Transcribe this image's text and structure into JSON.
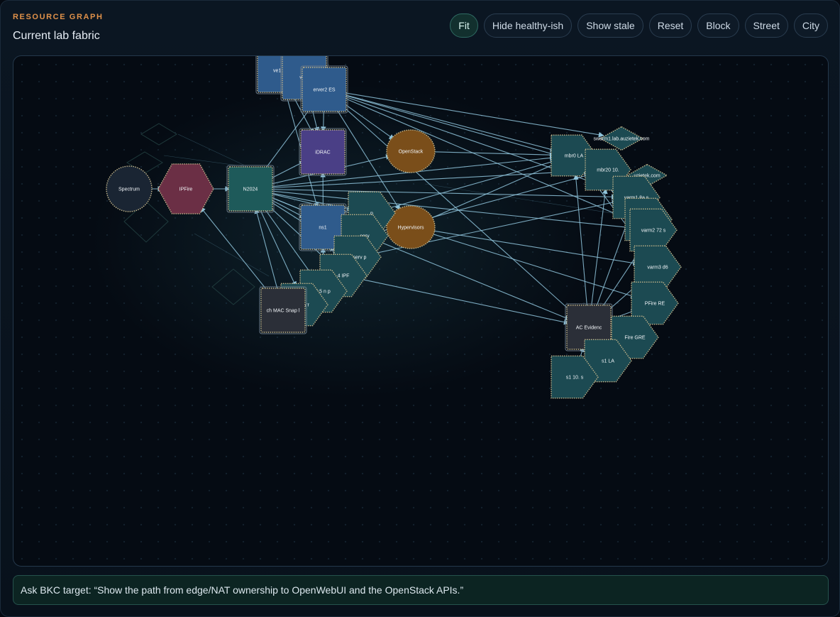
{
  "header": {
    "eyebrow": "RESOURCE GRAPH",
    "title": "Current lab fabric"
  },
  "toolbar": {
    "buttons": [
      "Fit",
      "Hide healthy-ish",
      "Show stale",
      "Reset",
      "Block",
      "Street",
      "City"
    ],
    "active": "Fit"
  },
  "ask": {
    "text": "Ask BKC target: “Show the path from edge/NAT ownership to OpenWebUI and the OpenStack APIs.”"
  },
  "colors": {
    "edge": "#8fc4dc",
    "server": "#2f5b8c",
    "idrac": "#4a3f86",
    "openstack": "#7a4e1a",
    "switch": "#1e5a5a",
    "firewall": "#6b2f45",
    "monitor": "#1a2533",
    "bridge": "#1c4a52",
    "evidence": "#2b2f38"
  },
  "graph": {
    "nodes": [
      {
        "id": "srv1",
        "label": "ve1 P",
        "kind": "server"
      },
      {
        "id": "srv2",
        "label": "ver1",
        "kind": "server"
      },
      {
        "id": "srv3",
        "label": "erver2 ES",
        "kind": "server"
      },
      {
        "id": "idrac",
        "label": "iDRAC",
        "kind": "idrac"
      },
      {
        "id": "openstack",
        "label": "OpenStack",
        "kind": "openstack"
      },
      {
        "id": "spectrum",
        "label": "Spectrum",
        "kind": "monitor"
      },
      {
        "id": "ipfire",
        "label": "IPFire",
        "kind": "firewall"
      },
      {
        "id": "n2024",
        "label": "N2024",
        "kind": "switch"
      },
      {
        "id": "ns1",
        "label": "ns1",
        "kind": "server"
      },
      {
        "id": "hypervisors",
        "label": "Hypervisors",
        "kind": "openstack"
      },
      {
        "id": "vm_a",
        "label": "p",
        "kind": "bridge"
      },
      {
        "id": "vm_b",
        "label": "serv",
        "kind": "bridge"
      },
      {
        "id": "vm_c",
        "label": "3 serv p",
        "kind": "bridge"
      },
      {
        "id": "vm_d",
        "label": "4 IPF",
        "kind": "bridge"
      },
      {
        "id": "vm_e",
        "label": "t 5 n p",
        "kind": "bridge"
      },
      {
        "id": "vm_f",
        "label": "warr",
        "kind": "bridge"
      },
      {
        "id": "mac",
        "label": "ch MAC Snap l",
        "kind": "evidence"
      },
      {
        "id": "swarm1lab",
        "label": "swarm1.lab.auzietek.com",
        "kind": "bridge"
      },
      {
        "id": "auzietek",
        "label": "uzietek.com",
        "kind": "bridge"
      },
      {
        "id": "mbr0",
        "label": "mbr0 LA",
        "kind": "bridge"
      },
      {
        "id": "mbr20",
        "label": "mbr20 10.",
        "kind": "bridge"
      },
      {
        "id": "warm1",
        "label": "varm1 8a s",
        "kind": "bridge"
      },
      {
        "id": "swcom",
        "label": "sw com",
        "kind": "bridge"
      },
      {
        "id": "warm2",
        "label": "varm2 72 s",
        "kind": "bridge"
      },
      {
        "id": "warm3",
        "label": "varm3 d6",
        "kind": "bridge"
      },
      {
        "id": "pfire_re",
        "label": "PFire RE",
        "kind": "bridge"
      },
      {
        "id": "evidence",
        "label": "AC Evidenc",
        "kind": "evidence"
      },
      {
        "id": "fire_gre",
        "label": "Fire GRE",
        "kind": "bridge"
      },
      {
        "id": "s1la",
        "label": "s1 LA",
        "kind": "bridge"
      },
      {
        "id": "s1_10",
        "label": "s1 10. s",
        "kind": "bridge"
      }
    ],
    "edges": [
      [
        "spectrum",
        "ipfire"
      ],
      [
        "ipfire",
        "n2024"
      ],
      [
        "n2024",
        "idrac"
      ],
      [
        "n2024",
        "openstack"
      ],
      [
        "n2024",
        "ns1"
      ],
      [
        "n2024",
        "hypervisors"
      ],
      [
        "n2024",
        "vm_a"
      ],
      [
        "n2024",
        "vm_b"
      ],
      [
        "n2024",
        "vm_c"
      ],
      [
        "n2024",
        "vm_d"
      ],
      [
        "n2024",
        "vm_e"
      ],
      [
        "n2024",
        "vm_f"
      ],
      [
        "n2024",
        "mbr0"
      ],
      [
        "n2024",
        "mbr20"
      ],
      [
        "n2024",
        "warm1"
      ],
      [
        "n2024",
        "warm2"
      ],
      [
        "n2024",
        "evidence"
      ],
      [
        "srv3",
        "mbr0"
      ],
      [
        "srv3",
        "swarm1lab"
      ],
      [
        "srv3",
        "mbr20"
      ],
      [
        "srv3",
        "warm1"
      ],
      [
        "srv3",
        "warm2"
      ],
      [
        "srv3",
        "evidence"
      ],
      [
        "srv1",
        "idrac"
      ],
      [
        "srv2",
        "idrac"
      ],
      [
        "srv3",
        "idrac"
      ],
      [
        "srv3",
        "n2024"
      ],
      [
        "srv3",
        "openstack"
      ],
      [
        "srv3",
        "hypervisors"
      ],
      [
        "srv1",
        "ns1"
      ],
      [
        "openstack",
        "mbr0"
      ],
      [
        "hypervisors",
        "warm3"
      ],
      [
        "hypervisors",
        "mbr0"
      ],
      [
        "hypervisors",
        "pfire_re"
      ],
      [
        "mac",
        "n2024"
      ],
      [
        "mac",
        "vm_f"
      ],
      [
        "mac",
        "ipfire"
      ],
      [
        "vm_d",
        "evidence"
      ],
      [
        "vm_a",
        "mbr0"
      ],
      [
        "vm_b",
        "mbr20"
      ],
      [
        "vm_c",
        "warm1"
      ],
      [
        "evidence",
        "mbr0"
      ],
      [
        "evidence",
        "mbr20"
      ],
      [
        "evidence",
        "warm1"
      ],
      [
        "evidence",
        "warm2"
      ],
      [
        "evidence",
        "warm3"
      ],
      [
        "evidence",
        "pfire_re"
      ],
      [
        "s1_10",
        "evidence"
      ],
      [
        "s1la",
        "evidence"
      ],
      [
        "fire_gre",
        "warm3"
      ],
      [
        "mbr0",
        "warm3"
      ],
      [
        "mbr20",
        "warm2"
      ],
      [
        "warm1",
        "pfire_re"
      ],
      [
        "mbr20",
        "pfire_re"
      ],
      [
        "mbr0",
        "warm2"
      ],
      [
        "vm_e",
        "ns1"
      ],
      [
        "vm_e",
        "idrac"
      ],
      [
        "vm_d",
        "ns1"
      ]
    ]
  }
}
